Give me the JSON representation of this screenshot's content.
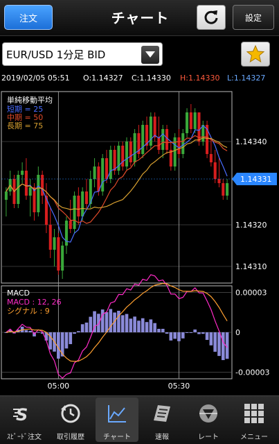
{
  "header": {
    "order_label": "注文",
    "title": "チャート",
    "settings_label": "設定"
  },
  "selector": {
    "symbol": "EUR/USD 1分足 BID"
  },
  "ohlc": {
    "datetime": "2019/02/05 05:51",
    "open": "O:1.14327",
    "close": "C:1.14330",
    "high": "H:1.14330",
    "low": "L:1.14327"
  },
  "colors": {
    "high_label": "#ff5a3c",
    "low_label": "#6aa9ff",
    "up_candle": "#3aa83a",
    "down_candle": "#d81e1e",
    "ma_short": "#4a6cff",
    "ma_mid": "#e04a2a",
    "ma_long": "#d8a030",
    "macd_line": "#ff2bc8",
    "signal_line": "#ffa030",
    "macd_hist": "#8a8ad8",
    "price_tag": "#2a86ff"
  },
  "chart_data": {
    "type": "candlestick",
    "price_panel": {
      "title": "単純移動平均",
      "legend": [
        {
          "name": "短期",
          "value": "25"
        },
        {
          "name": "中期",
          "value": "50"
        },
        {
          "name": "長期",
          "value": "75"
        }
      ],
      "y_ticks": [
        "1.14340",
        "1.14320",
        "1.14310"
      ],
      "current_price": "1.14331",
      "ylim": [
        1.14306,
        1.14352
      ]
    },
    "macd_panel": {
      "title": "MACD",
      "macd_label": "MACD : 12, 26",
      "signal_label": "シグナル : 9",
      "y_ticks": [
        "0.00003",
        "0",
        "-0.00003"
      ],
      "ylim": [
        -3.5e-05,
        3.5e-05
      ]
    },
    "x_ticks": [
      "05:00",
      "05:30"
    ],
    "candles": [
      [
        1.14326,
        1.14329,
        1.14322,
        1.14328
      ],
      [
        1.14328,
        1.14333,
        1.14327,
        1.14331
      ],
      [
        1.14331,
        1.14332,
        1.14324,
        1.14325
      ],
      [
        1.14325,
        1.14333,
        1.14324,
        1.14332
      ],
      [
        1.14332,
        1.14335,
        1.1433,
        1.14333
      ],
      [
        1.14333,
        1.14336,
        1.14326,
        1.14327
      ],
      [
        1.14327,
        1.14331,
        1.14322,
        1.14329
      ],
      [
        1.14329,
        1.1433,
        1.14321,
        1.14323
      ],
      [
        1.14323,
        1.14334,
        1.14322,
        1.14332
      ],
      [
        1.14332,
        1.14333,
        1.14325,
        1.14327
      ],
      [
        1.14327,
        1.1433,
        1.14318,
        1.1432
      ],
      [
        1.1432,
        1.14324,
        1.14312,
        1.14314
      ],
      [
        1.14314,
        1.14319,
        1.1431,
        1.14317
      ],
      [
        1.14317,
        1.14318,
        1.14308,
        1.14309
      ],
      [
        1.14309,
        1.14316,
        1.14307,
        1.14315
      ],
      [
        1.14315,
        1.14322,
        1.14313,
        1.14321
      ],
      [
        1.14321,
        1.14326,
        1.14318,
        1.14319
      ],
      [
        1.14319,
        1.14328,
        1.14318,
        1.14327
      ],
      [
        1.14327,
        1.14329,
        1.1432,
        1.14322
      ],
      [
        1.14322,
        1.14329,
        1.14321,
        1.14328
      ],
      [
        1.14328,
        1.14331,
        1.14324,
        1.14325
      ],
      [
        1.14325,
        1.14333,
        1.14324,
        1.14331
      ],
      [
        1.14331,
        1.14336,
        1.14329,
        1.14334
      ],
      [
        1.14334,
        1.14335,
        1.14327,
        1.14328
      ],
      [
        1.14328,
        1.14337,
        1.14327,
        1.14336
      ],
      [
        1.14336,
        1.14338,
        1.1433,
        1.14331
      ],
      [
        1.14331,
        1.14339,
        1.1433,
        1.14338
      ],
      [
        1.14338,
        1.14339,
        1.14332,
        1.14333
      ],
      [
        1.14333,
        1.1434,
        1.14332,
        1.14339
      ],
      [
        1.14339,
        1.1434,
        1.14333,
        1.14334
      ],
      [
        1.14334,
        1.14341,
        1.14333,
        1.1434
      ],
      [
        1.1434,
        1.14341,
        1.14334,
        1.14335
      ],
      [
        1.14335,
        1.14343,
        1.14334,
        1.14342
      ],
      [
        1.14342,
        1.14344,
        1.14336,
        1.14337
      ],
      [
        1.14337,
        1.14345,
        1.14336,
        1.14344
      ],
      [
        1.14344,
        1.14346,
        1.14338,
        1.14339
      ],
      [
        1.14339,
        1.14347,
        1.14338,
        1.14346
      ],
      [
        1.14346,
        1.14347,
        1.1434,
        1.14341
      ],
      [
        1.14341,
        1.14346,
        1.14337,
        1.14338
      ],
      [
        1.14338,
        1.14344,
        1.14336,
        1.14343
      ],
      [
        1.14343,
        1.14344,
        1.14337,
        1.14338
      ],
      [
        1.14338,
        1.1434,
        1.14333,
        1.14334
      ],
      [
        1.14334,
        1.14342,
        1.14333,
        1.14341
      ],
      [
        1.14341,
        1.14343,
        1.14336,
        1.14337
      ],
      [
        1.14337,
        1.14343,
        1.14336,
        1.14342
      ],
      [
        1.14342,
        1.14348,
        1.14341,
        1.14347
      ],
      [
        1.14347,
        1.14349,
        1.14342,
        1.14343
      ],
      [
        1.14343,
        1.14348,
        1.14342,
        1.14347
      ],
      [
        1.14347,
        1.14347,
        1.14339,
        1.1434
      ],
      [
        1.1434,
        1.14345,
        1.14339,
        1.14344
      ],
      [
        1.14344,
        1.14345,
        1.14336,
        1.14337
      ],
      [
        1.14337,
        1.14341,
        1.14334,
        1.14335
      ],
      [
        1.14335,
        1.14338,
        1.1433,
        1.14331
      ],
      [
        1.14331,
        1.14336,
        1.14329,
        1.1433
      ],
      [
        1.1433,
        1.14331,
        1.14326,
        1.14327
      ],
      [
        1.14327,
        1.14331,
        1.14326,
        1.1433
      ]
    ]
  },
  "bottom_nav": [
    {
      "label": "ｽﾋﾟｰﾄﾞ注文",
      "icon": "speed-order-icon"
    },
    {
      "label": "取引履歴",
      "icon": "history-icon"
    },
    {
      "label": "チャート",
      "icon": "chart-icon"
    },
    {
      "label": "速報",
      "icon": "news-icon"
    },
    {
      "label": "レート",
      "icon": "rate-icon"
    },
    {
      "label": "メニュー",
      "icon": "menu-grid-icon"
    }
  ]
}
